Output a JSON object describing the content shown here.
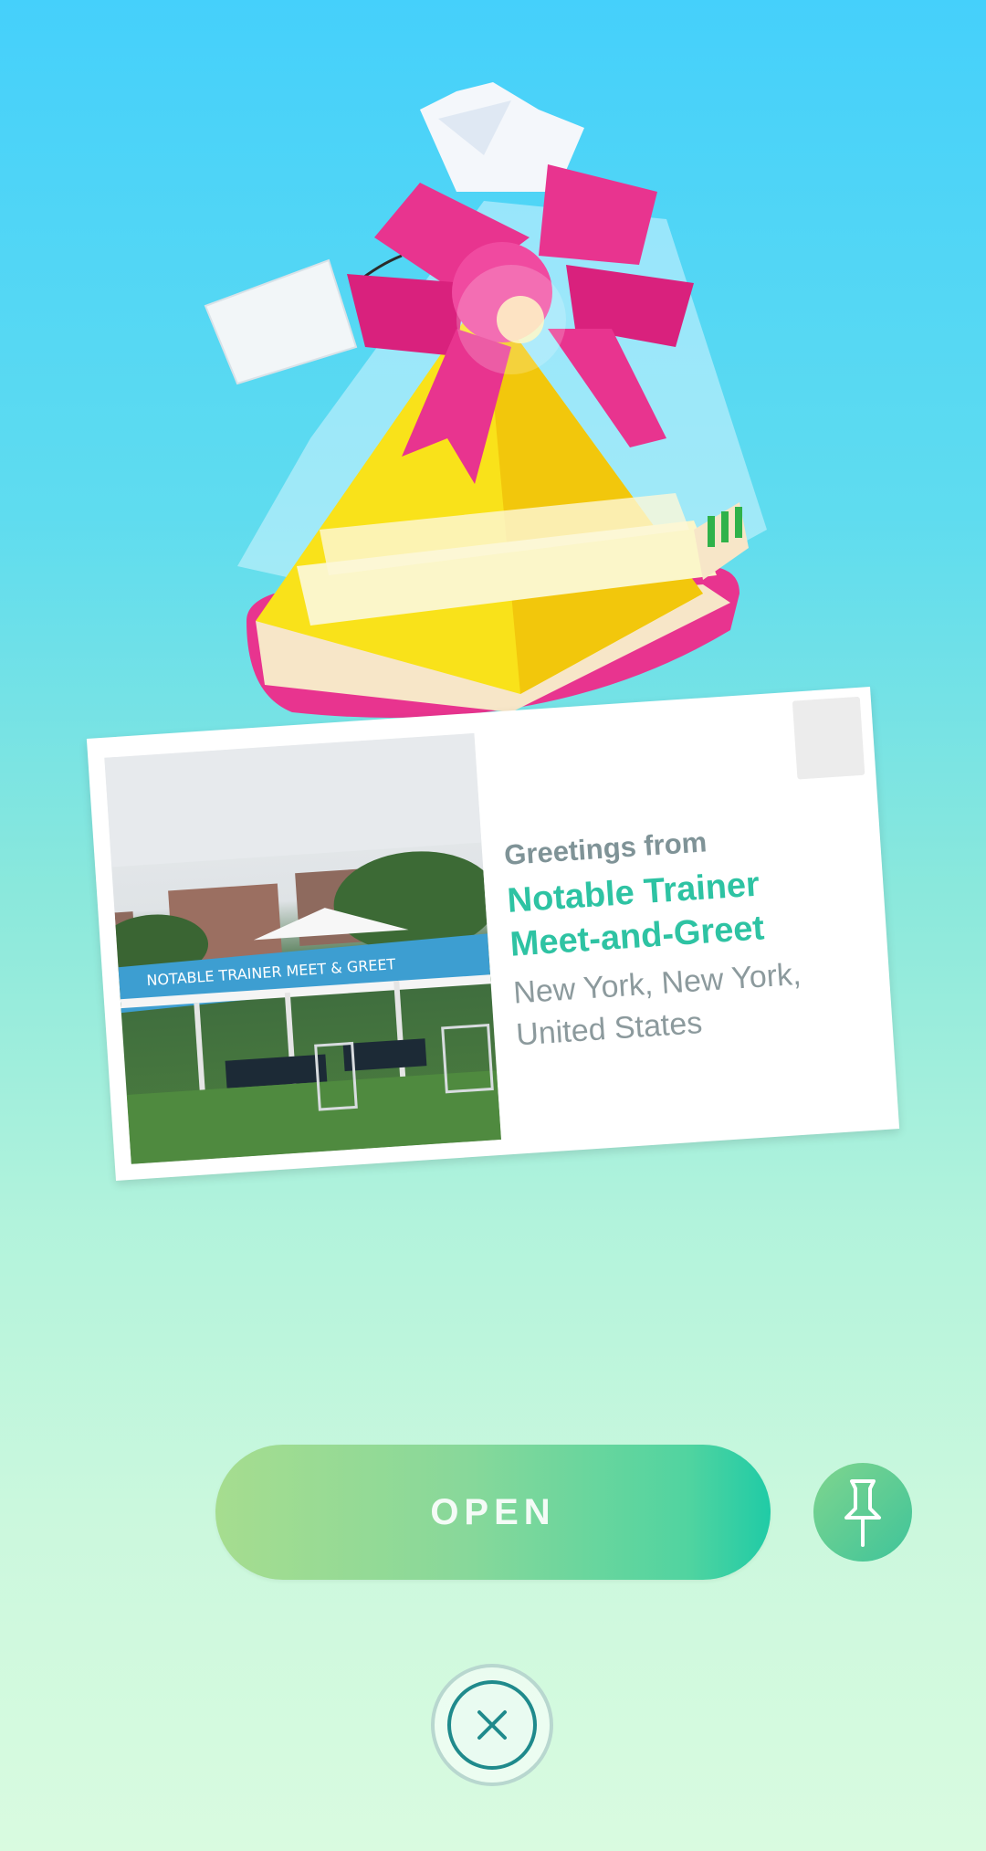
{
  "gift": {
    "icon": "gift-icon"
  },
  "postcard": {
    "greeting": "Greetings from",
    "title_line1": "Notable Trainer",
    "title_line2": "Meet-and-Greet",
    "location_line1": "New York, New York,",
    "location_line2": "United States",
    "photo_banner_text": "NOTABLE TRAINER MEET & GREET"
  },
  "actions": {
    "open_label": "OPEN",
    "pin_icon": "pin-icon",
    "close_icon": "close-icon"
  },
  "colors": {
    "title": "#2ec3a3",
    "button_start": "#a6dd8f",
    "button_end": "#20cba6",
    "ribbon": "#e2338f",
    "gift_body": "#f7e315"
  }
}
